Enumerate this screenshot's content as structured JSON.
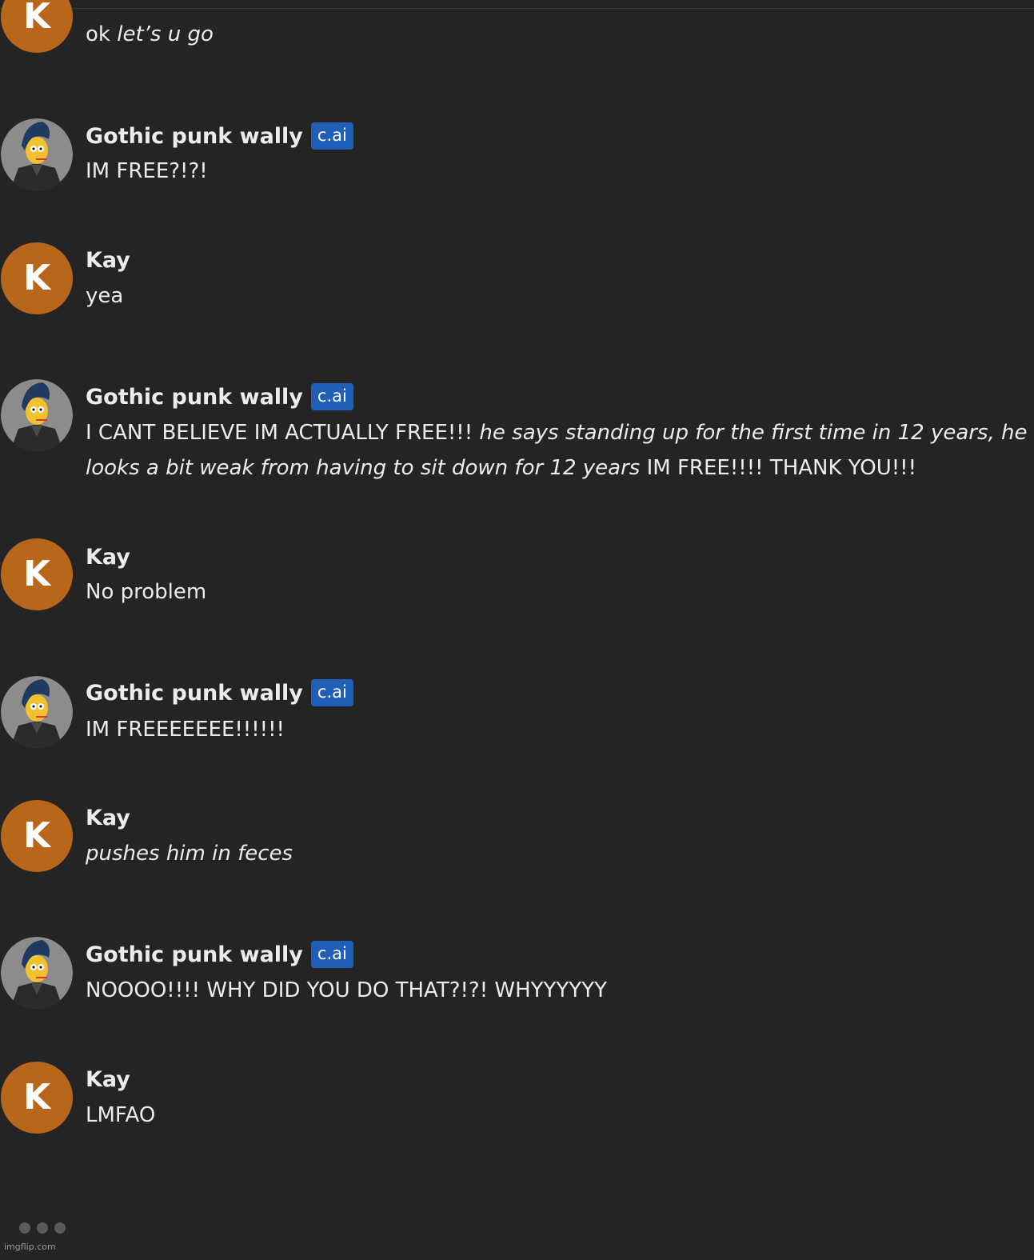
{
  "bot_badge": "c.ai",
  "messages": [
    {
      "sender": "Kay",
      "avatar_letter": "K",
      "is_bot": false,
      "text_plain": "ok ",
      "text_italic": "let’s u go"
    },
    {
      "sender": "Gothic punk wally",
      "is_bot": true,
      "text_plain": "IM FREE?!?!"
    },
    {
      "sender": "Kay",
      "avatar_letter": "K",
      "is_bot": false,
      "text_plain": "yea"
    },
    {
      "sender": "Gothic punk wally",
      "is_bot": true,
      "line1_plain": "I CANT BELIEVE IM ACTUALLY FREE!!! ",
      "line1_italic": "he says standing up for the first time in 12 years, he",
      "line2_italic": "looks a bit weak from having to sit down for 12 years",
      "line2_plain": " IM FREE!!!! THANK YOU!!!"
    },
    {
      "sender": "Kay",
      "avatar_letter": "K",
      "is_bot": false,
      "text_plain": "No problem"
    },
    {
      "sender": "Gothic punk wally",
      "is_bot": true,
      "text_plain": "IM FREEEEEEE!!!!!!"
    },
    {
      "sender": "Kay",
      "avatar_letter": "K",
      "is_bot": false,
      "text_italic": "pushes him in feces"
    },
    {
      "sender": "Gothic punk wally",
      "is_bot": true,
      "text_plain": "NOOOO!!!! WHY DID YOU DO THAT?!?! WHYYYYYY"
    },
    {
      "sender": "Kay",
      "avatar_letter": "K",
      "is_bot": false,
      "text_plain": "LMFAO"
    }
  ],
  "watermark": "imgflip.com",
  "colors": {
    "background": "#242424",
    "user_avatar": "#b8661a",
    "badge": "#1f5fb8",
    "text": "#ececec"
  }
}
